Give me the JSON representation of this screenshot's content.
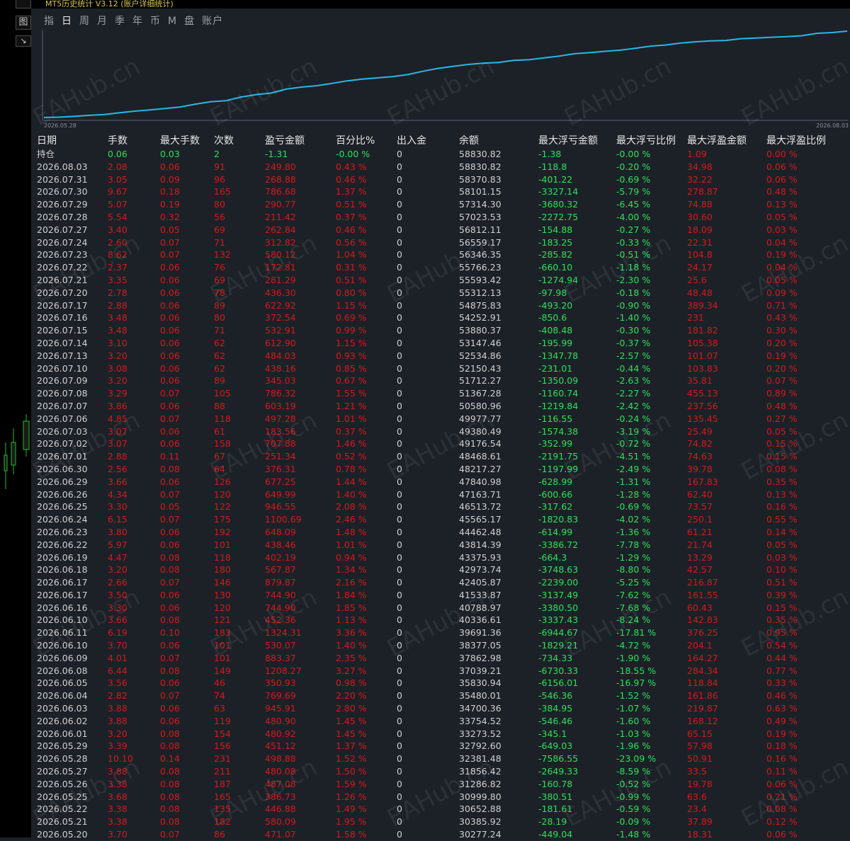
{
  "window": {
    "title": "MT5历史统计 V3.12 (账户详细统计)"
  },
  "left_buttons": [
    {
      "label": ""
    },
    {
      "label": "图"
    },
    {
      "label": "↘"
    }
  ],
  "tabs": [
    "指",
    "日",
    "周",
    "月",
    "季",
    "年",
    "币",
    "M",
    "盘",
    "账户"
  ],
  "active_tab": 1,
  "chart": {
    "start_label": "2026.05.28",
    "end_label": "2026.08.03",
    "line_color": "#29b7e6"
  },
  "table": {
    "headers": [
      "日期",
      "手数",
      "最大手数",
      "次数",
      "盈亏金额",
      "百分比%",
      "出入金",
      "余额",
      "最大浮亏金额",
      "最大浮亏比例",
      "最大浮盈金额",
      "最大浮盈比例"
    ],
    "rows": [
      [
        "持仓",
        "0.06",
        "0.03",
        "2",
        "-1.31",
        "-0.00 %",
        "0",
        "58830.82",
        "-1.38",
        "-0.00 %",
        "1.09",
        "0.00 %"
      ],
      [
        "2026.08.03",
        "2.08",
        "0.06",
        "91",
        "249.80",
        "0.43 %",
        "0",
        "58830.82",
        "-118.8",
        "-0.20 %",
        "34.98",
        "0.06 %"
      ],
      [
        "2026.07.31",
        "3.05",
        "0.09",
        "96",
        "268.88",
        "0.46 %",
        "0",
        "58370.83",
        "-401.22",
        "-0.69 %",
        "32.22",
        "0.06 %"
      ],
      [
        "2026.07.30",
        "9.67",
        "0.18",
        "165",
        "786.68",
        "1.37 %",
        "0",
        "58101.15",
        "-3327.14",
        "-5.79 %",
        "278.87",
        "0.48 %"
      ],
      [
        "2026.07.29",
        "5.07",
        "0.19",
        "80",
        "290.77",
        "0.51 %",
        "0",
        "57314.30",
        "-3680.32",
        "-6.45 %",
        "74.88",
        "0.13 %"
      ],
      [
        "2026.07.28",
        "5.54",
        "0.32",
        "56",
        "211.42",
        "0.37 %",
        "0",
        "57023.53",
        "-2272.75",
        "-4.00 %",
        "30.60",
        "0.05 %"
      ],
      [
        "2026.07.27",
        "3.40",
        "0.05",
        "69",
        "262.84",
        "0.46 %",
        "0",
        "56812.11",
        "-154.88",
        "-0.27 %",
        "18.09",
        "0.03 %"
      ],
      [
        "2026.07.24",
        "2.60",
        "0.07",
        "71",
        "312.82",
        "0.56 %",
        "0",
        "56559.17",
        "-183.25",
        "-0.33 %",
        "22.31",
        "0.04 %"
      ],
      [
        "2026.07.23",
        "8.62",
        "0.07",
        "132",
        "580.12",
        "1.04 %",
        "0",
        "56346.35",
        "-285.82",
        "-0.51 %",
        "104.8",
        "0.19 %"
      ],
      [
        "2026.07.22",
        "2.37",
        "0.06",
        "76",
        "172.81",
        "0.31 %",
        "0",
        "55766.23",
        "-660.10",
        "-1.18 %",
        "24.17",
        "0.04 %"
      ],
      [
        "2026.07.21",
        "3.35",
        "0.06",
        "69",
        "281.29",
        "0.51 %",
        "0",
        "55593.42",
        "-1274.94",
        "-2.30 %",
        "25.6",
        "0.05 %"
      ],
      [
        "2026.07.20",
        "2.78",
        "0.06",
        "78",
        "436.30",
        "0.80 %",
        "0",
        "55312.13",
        "-97.98",
        "-0.18 %",
        "48.48",
        "0.09 %"
      ],
      [
        "2026.07.17",
        "2.88",
        "0.06",
        "89",
        "622.92",
        "1.15 %",
        "0",
        "54875.83",
        "-493.20",
        "-0.90 %",
        "389.34",
        "0.71 %"
      ],
      [
        "2026.07.16",
        "3.48",
        "0.06",
        "80",
        "372.54",
        "0.69 %",
        "0",
        "54252.91",
        "-850.6",
        "-1.40 %",
        "231",
        "0.43 %"
      ],
      [
        "2026.07.15",
        "3.48",
        "0.06",
        "71",
        "532.91",
        "0.99 %",
        "0",
        "53880.37",
        "-408.48",
        "-0.30 %",
        "181.82",
        "0.30 %"
      ],
      [
        "2026.07.14",
        "3.10",
        "0.06",
        "62",
        "612.90",
        "1.15 %",
        "0",
        "53147.46",
        "-195.99",
        "-0.37 %",
        "105.38",
        "0.20 %"
      ],
      [
        "2026.07.13",
        "3.20",
        "0.06",
        "62",
        "484.03",
        "0.93 %",
        "0",
        "52534.86",
        "-1347.78",
        "-2.57 %",
        "101.07",
        "0.19 %"
      ],
      [
        "2026.07.10",
        "3.08",
        "0.06",
        "62",
        "438.16",
        "0.85 %",
        "0",
        "52150.43",
        "-231.01",
        "-0.44 %",
        "103.83",
        "0.20 %"
      ],
      [
        "2026.07.09",
        "3.20",
        "0.06",
        "89",
        "345.03",
        "0.67 %",
        "0",
        "51712.27",
        "-1350.09",
        "-2.63 %",
        "35.81",
        "0.07 %"
      ],
      [
        "2026.07.08",
        "3.29",
        "0.07",
        "105",
        "786.32",
        "1.55 %",
        "0",
        "51367.28",
        "-1160.74",
        "-2.27 %",
        "455.13",
        "0.89 %"
      ],
      [
        "2026.07.07",
        "3.86",
        "0.06",
        "88",
        "603.19",
        "1.21 %",
        "0",
        "50580.96",
        "-1219.84",
        "-2.42 %",
        "237.56",
        "0.48 %"
      ],
      [
        "2026.07.06",
        "4.85",
        "0.07",
        "118",
        "497.28",
        "1.01 %",
        "0",
        "49977.77",
        "-116.55",
        "-0.24 %",
        "135.45",
        "0.27 %"
      ],
      [
        "2026.07.03",
        "3.07",
        "0.06",
        "61",
        "183.56",
        "0.37 %",
        "0",
        "49380.49",
        "-1574.38",
        "-3.19 %",
        "25.49",
        "0.05 %"
      ],
      [
        "2026.07.02",
        "3.07",
        "0.06",
        "158",
        "707.88",
        "1.46 %",
        "0",
        "49176.54",
        "-352.99",
        "-0.72 %",
        "74.82",
        "0.15 %"
      ],
      [
        "2026.07.01",
        "2.88",
        "0.11",
        "67",
        "251.34",
        "0.52 %",
        "0",
        "48468.61",
        "-2191.75",
        "-4.51 %",
        "74.63",
        "0.15 %"
      ],
      [
        "2026.06.30",
        "2.56",
        "0.08",
        "64",
        "376.31",
        "0.78 %",
        "0",
        "48217.27",
        "-1197.99",
        "-2.49 %",
        "39.78",
        "0.08 %"
      ],
      [
        "2026.06.29",
        "3.66",
        "0.06",
        "126",
        "677.25",
        "1.44 %",
        "0",
        "47840.98",
        "-628.99",
        "-1.31 %",
        "167.83",
        "0.35 %"
      ],
      [
        "2026.06.26",
        "4.34",
        "0.07",
        "120",
        "649.99",
        "1.40 %",
        "0",
        "47163.71",
        "-600.66",
        "-1.28 %",
        "62.40",
        "0.13 %"
      ],
      [
        "2026.06.25",
        "3.30",
        "0.05",
        "122",
        "946.55",
        "2.08 %",
        "0",
        "46513.72",
        "-317.62",
        "-0.69 %",
        "73.57",
        "0.16 %"
      ],
      [
        "2026.06.24",
        "6.15",
        "0.07",
        "175",
        "1100.69",
        "2.46 %",
        "0",
        "45565.17",
        "-1820.83",
        "-4.02 %",
        "250.1",
        "0.55 %"
      ],
      [
        "2026.06.23",
        "3.80",
        "0.06",
        "192",
        "648.09",
        "1.48 %",
        "0",
        "44462.48",
        "-614.99",
        "-1.36 %",
        "61.21",
        "0.14 %"
      ],
      [
        "2026.06.22",
        "5.97",
        "0.06",
        "101",
        "438.46",
        "1.01 %",
        "0",
        "43814.39",
        "-3386.72",
        "-7.78 %",
        "21.74",
        "0.05 %"
      ],
      [
        "2026.06.19",
        "4.47",
        "0.08",
        "118",
        "402.19",
        "0.94 %",
        "0",
        "43375.93",
        "-664.3",
        "-1.29 %",
        "13.29",
        "0.03 %"
      ],
      [
        "2026.06.18",
        "3.20",
        "0.08",
        "180",
        "567.87",
        "1.34 %",
        "0",
        "42973.74",
        "-3748.63",
        "-8.80 %",
        "42.57",
        "0.10 %"
      ],
      [
        "2026.06.17",
        "2.66",
        "0.07",
        "146",
        "879.87",
        "2.16 %",
        "0",
        "42405.87",
        "-2239.00",
        "-5.25 %",
        "216.87",
        "0.51 %"
      ],
      [
        "2026.06.17",
        "3.50",
        "0.06",
        "130",
        "744.90",
        "1.84 %",
        "0",
        "41533.87",
        "-3137.49",
        "-7.62 %",
        "161.55",
        "0.39 %"
      ],
      [
        "2026.06.16",
        "3.30",
        "0.06",
        "120",
        "744.90",
        "1.85 %",
        "0",
        "40788.97",
        "-3380.50",
        "-7.68 %",
        "60.43",
        "0.15 %"
      ],
      [
        "2026.06.10",
        "3.66",
        "0.08",
        "121",
        "452.36",
        "1.13 %",
        "0",
        "40336.61",
        "-3337.43",
        "-8.24 %",
        "142.83",
        "0.35 %"
      ],
      [
        "2026.06.11",
        "6.19",
        "0.10",
        "183",
        "1324.31",
        "3.36 %",
        "0",
        "39691.36",
        "-6944.67",
        "-17.81 %",
        "376.25",
        "0.95 %"
      ],
      [
        "2026.06.10",
        "3.70",
        "0.06",
        "101",
        "530.07",
        "1.40 %",
        "0",
        "38377.05",
        "-1829.21",
        "-4.72 %",
        "204.1",
        "0.54 %"
      ],
      [
        "2026.06.09",
        "4.01",
        "0.07",
        "101",
        "883.37",
        "2.35 %",
        "0",
        "37862.98",
        "-734.33",
        "-1.90 %",
        "164.27",
        "0.44 %"
      ],
      [
        "2026.06.08",
        "6.44",
        "0.08",
        "149",
        "1208.27",
        "3.27 %",
        "0",
        "37039.21",
        "-6730.33",
        "-18.55 %",
        "284.34",
        "0.77 %"
      ],
      [
        "2026.06.05",
        "3.56",
        "0.06",
        "46",
        "350.93",
        "0.98 %",
        "0",
        "35830.94",
        "-6156.01",
        "-16.97 %",
        "118.84",
        "0.33 %"
      ],
      [
        "2026.06.04",
        "2.82",
        "0.07",
        "74",
        "769.69",
        "2.20 %",
        "0",
        "35480.01",
        "-546.36",
        "-1.52 %",
        "161.86",
        "0.46 %"
      ],
      [
        "2026.06.03",
        "3.88",
        "0.06",
        "63",
        "945.91",
        "2.80 %",
        "0",
        "34700.36",
        "-384.95",
        "-1.07 %",
        "219.87",
        "0.63 %"
      ],
      [
        "2026.06.02",
        "3.88",
        "0.06",
        "119",
        "480.90",
        "1.45 %",
        "0",
        "33754.52",
        "-546.46",
        "-1.60 %",
        "168.12",
        "0.49 %"
      ],
      [
        "2026.06.01",
        "3.20",
        "0.08",
        "154",
        "480.92",
        "1.45 %",
        "0",
        "33273.52",
        "-345.1",
        "-1.03 %",
        "65.15",
        "0.19 %"
      ],
      [
        "2026.05.29",
        "3.39",
        "0.08",
        "156",
        "451.12",
        "1.37 %",
        "0",
        "32792.60",
        "-649.03",
        "-1.96 %",
        "57.98",
        "0.18 %"
      ],
      [
        "2026.05.28",
        "10.10",
        "0.14",
        "231",
        "498.88",
        "1.52 %",
        "0",
        "32381.48",
        "-7586.55",
        "-23.09 %",
        "50.91",
        "0.16 %"
      ],
      [
        "2026.05.27",
        "3.88",
        "0.08",
        "211",
        "480.08",
        "1.50 %",
        "0",
        "31856.42",
        "-2649.33",
        "-8.59 %",
        "33.5",
        "0.11 %"
      ],
      [
        "2026.05.26",
        "3.38",
        "0.08",
        "187",
        "487.08",
        "1.59 %",
        "0",
        "31286.82",
        "-160.78",
        "-0.52 %",
        "19.78",
        "0.06 %"
      ],
      [
        "2026.05.25",
        "3.68",
        "0.08",
        "165",
        "386.73",
        "1.26 %",
        "0",
        "30999.80",
        "-380.51",
        "-0.99 %",
        "63.6",
        "0.21 %"
      ],
      [
        "2026.05.22",
        "3.38",
        "0.08",
        "135",
        "446.88",
        "1.49 %",
        "0",
        "30652.88",
        "-181.61",
        "-0.59 %",
        "23.4",
        "0.08 %"
      ],
      [
        "2026.05.21",
        "3.38",
        "0.08",
        "182",
        "580.09",
        "1.95 %",
        "0",
        "30385.92",
        "-28.19",
        "-0.09 %",
        "37.89",
        "0.12 %"
      ],
      [
        "2026.05.20",
        "3.70",
        "0.07",
        "86",
        "471.07",
        "1.58 %",
        "0",
        "30277.24",
        "-449.04",
        "-1.48 %",
        "18.31",
        "0.06 %"
      ]
    ]
  }
}
